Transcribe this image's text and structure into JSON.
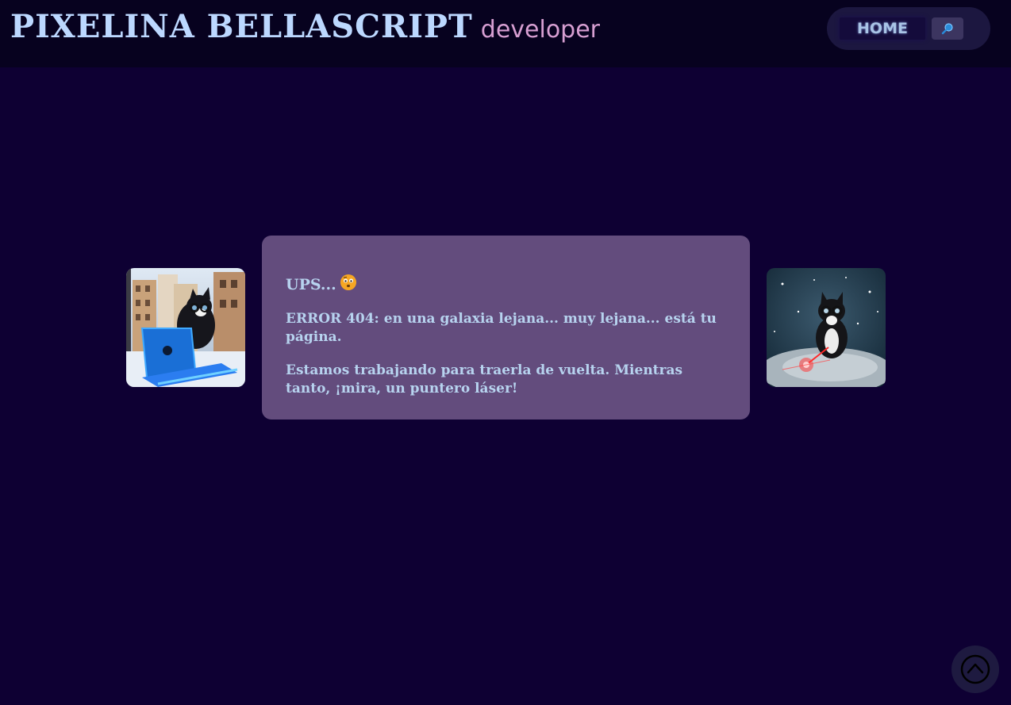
{
  "header": {
    "brand_name": "PIXELINA BELLASCRIPT",
    "brand_role": "developer",
    "nav": {
      "home_label": "HOME",
      "search_icon": "search-icon"
    }
  },
  "main": {
    "title": "UPS...",
    "title_emoji": "face-with-raised-eyebrow",
    "error_text": "ERROR 404: en una galaxia lejana... muy lejana... está tu página.",
    "message": "Estamos trabajando para traerla de vuelta. Mientras tanto, ¡mira, un puntero láser!",
    "images": [
      {
        "subject": "cat-with-glasses-using-laptop"
      },
      {
        "subject": "cat-with-glasses-and-laser-pointer"
      }
    ]
  },
  "scroll_top_icon": "chevron-up-circle-icon",
  "colors": {
    "background": "#0e0033",
    "header_bg": "#07021f",
    "card_bg": "#634c7d",
    "text_primary": "#b7d3ef",
    "accent_pink": "#d79fd2"
  }
}
